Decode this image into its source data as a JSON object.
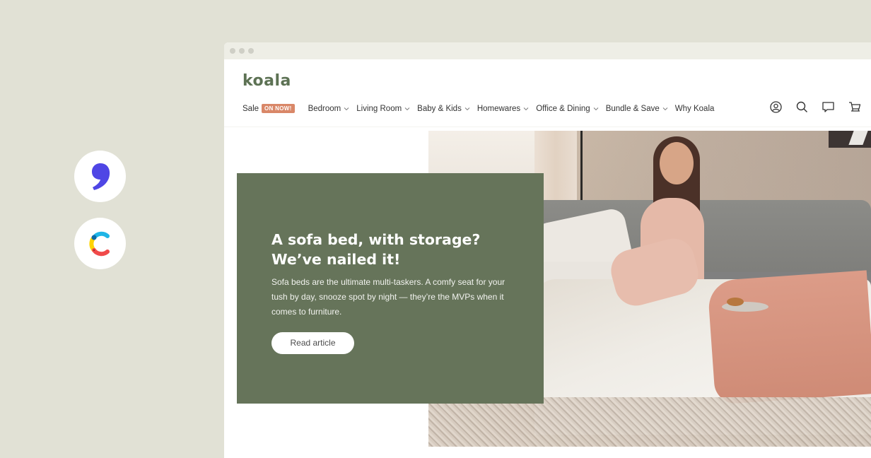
{
  "integrations": [
    {
      "name": "comma-logo",
      "color": "#4f46e5"
    },
    {
      "name": "contentful-logo",
      "colors": [
        "#ffd400",
        "#1fb5e6",
        "#f04a4a",
        "#0b6aa8"
      ]
    }
  ],
  "browser": {
    "dots": 3
  },
  "header": {
    "brand": "koala",
    "brand_color": "#5d7254",
    "nav": [
      {
        "label": "Sale",
        "badge": "ON NOW!",
        "has_dropdown": false
      },
      {
        "label": "Bedroom",
        "has_dropdown": true
      },
      {
        "label": "Living Room",
        "has_dropdown": true
      },
      {
        "label": "Baby & Kids",
        "has_dropdown": true
      },
      {
        "label": "Homewares",
        "has_dropdown": true
      },
      {
        "label": "Office & Dining",
        "has_dropdown": true
      },
      {
        "label": "Bundle & Save",
        "has_dropdown": true
      },
      {
        "label": "Why Koala",
        "has_dropdown": false
      }
    ],
    "icons": [
      "account-icon",
      "search-icon",
      "chat-icon",
      "cart-icon"
    ],
    "badge_color": "#d98768"
  },
  "hero": {
    "title": "A sofa bed, with storage? We’ve nailed it!",
    "body": "Sofa beds are the ultimate multi-taskers. A comfy seat for your tush by day, snooze spot by night — they’re the MVPs when it comes to furniture.",
    "cta": "Read article",
    "card_color": "#66745a",
    "image_alt": "Woman sitting on grey sofa bed with pink quilt and breakfast tray"
  }
}
